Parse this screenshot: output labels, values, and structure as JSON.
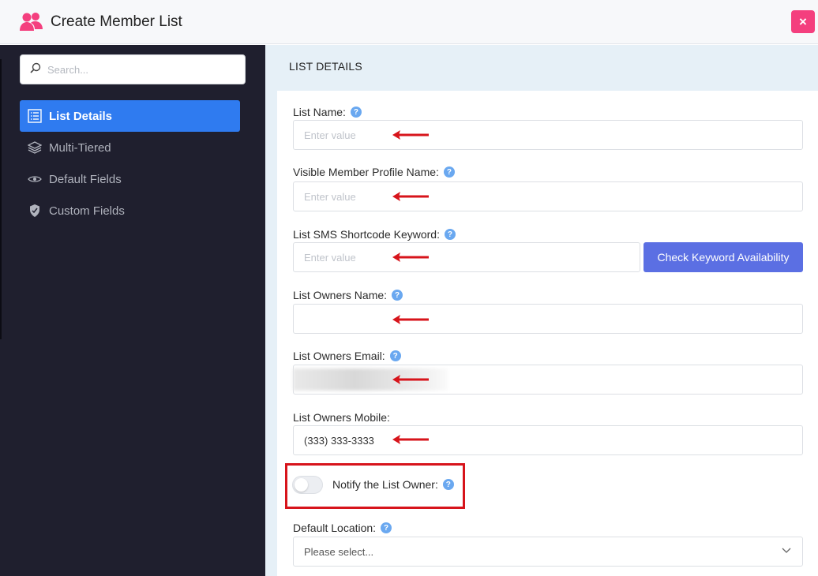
{
  "header": {
    "title": "Create Member List",
    "icon": "users-icon",
    "close_label": "×",
    "accent": "#f43f7e"
  },
  "sidebar": {
    "search_placeholder": "Search...",
    "items": [
      {
        "label": "List Details",
        "icon": "list-icon",
        "active": true
      },
      {
        "label": "Multi-Tiered",
        "icon": "layers-icon",
        "active": false
      },
      {
        "label": "Default Fields",
        "icon": "eye-icon",
        "active": false
      },
      {
        "label": "Custom Fields",
        "icon": "shield-hand-icon",
        "active": false
      }
    ]
  },
  "main": {
    "section_title": "LIST DETAILS",
    "fields": {
      "list_name": {
        "label": "List Name:",
        "placeholder": "Enter value",
        "value": ""
      },
      "visible_name": {
        "label": "Visible Member Profile Name:",
        "placeholder": "Enter value",
        "value": ""
      },
      "sms_keyword": {
        "label": "List SMS Shortcode Keyword:",
        "placeholder": "Enter value",
        "value": ""
      },
      "owner_name": {
        "label": "List Owners Name:",
        "placeholder": "",
        "value": ""
      },
      "owner_email": {
        "label": "List Owners Email:",
        "placeholder": "",
        "value": ""
      },
      "owner_mobile": {
        "label": "List Owners Mobile:",
        "placeholder": "",
        "value": "(333) 333-3333"
      }
    },
    "check_keyword_button": "Check Keyword Availability",
    "notify": {
      "label": "Notify the List Owner:",
      "enabled": false
    },
    "default_location": {
      "label": "Default Location:",
      "selected": "Please select..."
    },
    "help_glyph": "?"
  },
  "colors": {
    "sidebar_bg": "#1f1f2e",
    "active_item": "#2f7bf0",
    "button": "#5b6fe3",
    "annotation": "#d7141b"
  }
}
